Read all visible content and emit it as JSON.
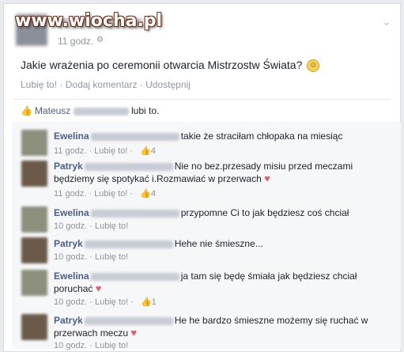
{
  "watermark": "www.wiocha.pl",
  "post": {
    "time": "11 godz.",
    "text": "Jakie wrażenia po ceremonii otwarcia Mistrzostw Świata?",
    "actions": [
      "Lubię to!",
      "Dodaj komentarz",
      "Udostępnij"
    ],
    "likes_name": "Mateusz",
    "likes_suffix": "lubi to."
  },
  "comments": [
    {
      "name": "Ewelina",
      "text": "takie że straciłam chłopaka na miesiąc",
      "time": "11 godz.",
      "like": "Lubię to!",
      "count": "4",
      "heart": false
    },
    {
      "name": "Patryk",
      "text": "Nie no bez.przesady misiu przed meczami będziemy się spotykać i.Rozmawiać w przerwach",
      "time": "11 godz.",
      "like": "Lubię to!",
      "count": "4",
      "heart": true
    },
    {
      "name": "Ewelina",
      "text": "przypomne Ci to jak będziesz coś chciał",
      "time": "10 godz.",
      "like": "Lubię to!",
      "count": "",
      "heart": false
    },
    {
      "name": "Patryk",
      "text": "Hehe nie śmieszne...",
      "time": "10 godz.",
      "like": "Lubię to!",
      "count": "",
      "heart": false
    },
    {
      "name": "Ewelina",
      "text": "ja tam się będę śmiała jak będziesz chciał poruchać",
      "time": "10 godz.",
      "like": "Lubię to!",
      "count": "1",
      "heart": true
    },
    {
      "name": "Patryk",
      "text": "He he bardzo śmieszne możemy się ruchać w przerwach meczu",
      "time": "10 godz.",
      "like": "Lubię to!",
      "count": "",
      "heart": true
    }
  ],
  "colors": {
    "link": "#4b5e8a",
    "meta": "#90949c",
    "heart": "#e85a6f",
    "comment_bg": "#f6f7f9"
  }
}
